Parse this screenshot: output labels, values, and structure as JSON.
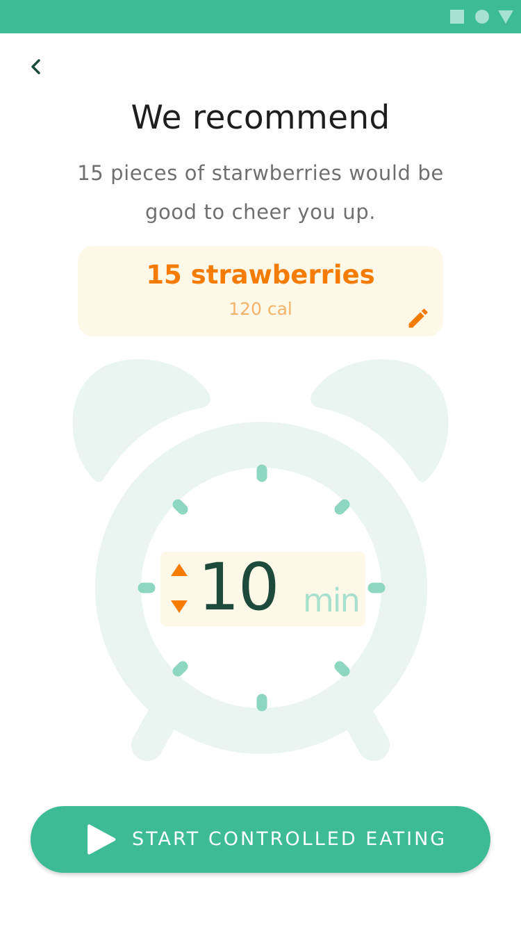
{
  "colors": {
    "accent": "#3dbb94",
    "orange": "#f57c00",
    "card_background": "#fef8e8",
    "timer_text": "#1e4a3c",
    "clock_fill": "#eaf4f1",
    "tick_marks": "#8dd6bf"
  },
  "status_bar": {
    "icons": [
      "square-icon",
      "circle-icon",
      "triangle-icon"
    ]
  },
  "header": {
    "title": "We recommend",
    "subtitle": "15 pieces of starwberries would be good to cheer you up."
  },
  "food_card": {
    "name": "15 strawberries",
    "calories": "120 cal",
    "edit_icon": "pencil-icon"
  },
  "timer": {
    "value": "10",
    "unit": "min",
    "increase_icon": "triangle-up-icon",
    "decrease_icon": "triangle-down-icon"
  },
  "actions": {
    "start_label": "START CONTROLLED EATING",
    "start_icon": "play-icon"
  }
}
